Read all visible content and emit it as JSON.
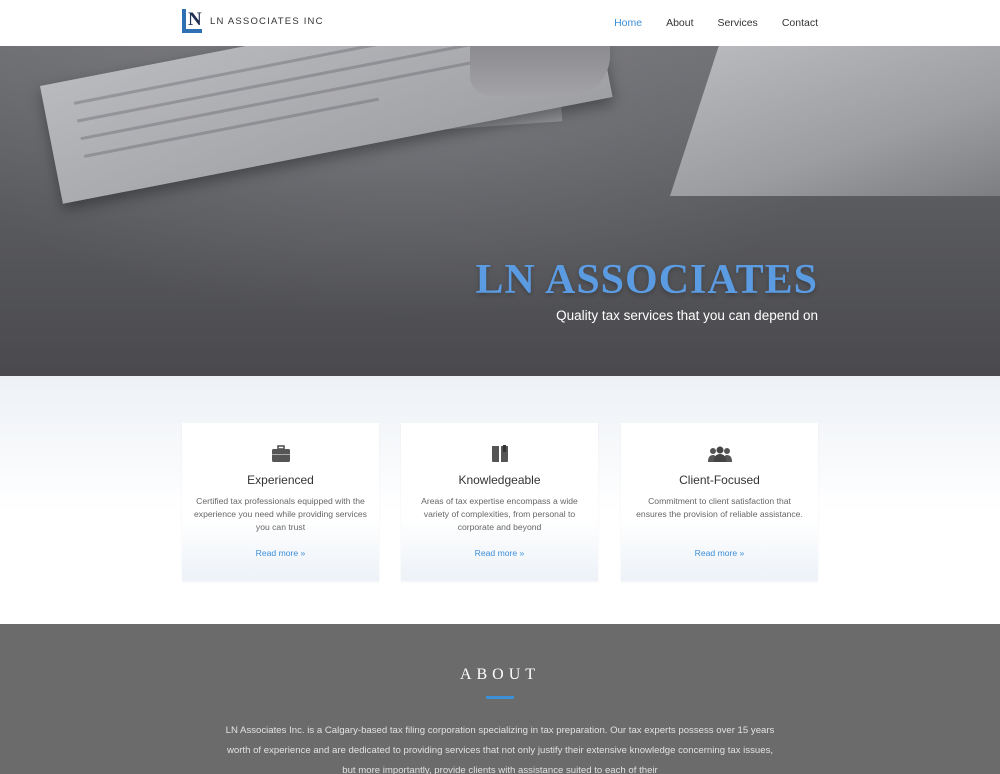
{
  "header": {
    "logo_text": "LN ASSOCIATES INC",
    "logo_letters": "N",
    "nav": [
      {
        "label": "Home",
        "active": true
      },
      {
        "label": "About",
        "active": false
      },
      {
        "label": "Services",
        "active": false
      },
      {
        "label": "Contact",
        "active": false
      }
    ]
  },
  "hero": {
    "title": "LN ASSOCIATES",
    "subtitle": "Quality tax services that you can depend on"
  },
  "features": [
    {
      "icon": "briefcase-icon",
      "title": "Experienced",
      "text": "Certified tax professionals equipped with the experience you need while providing services you can trust",
      "link": "Read more »"
    },
    {
      "icon": "book-icon",
      "title": "Knowledgeable",
      "text": "Areas of tax expertise encompass a wide variety of complexities, from personal to corporate and beyond",
      "link": "Read more »"
    },
    {
      "icon": "users-icon",
      "title": "Client-Focused",
      "text": "Commitment to client satisfaction that ensures the provision of reliable assistance.",
      "link": "Read more »"
    }
  ],
  "about": {
    "heading": "ABOUT",
    "text": "LN Associates Inc. is a Calgary-based tax filing corporation specializing in tax preparation. Our tax experts possess over 15 years worth of experience and are dedicated to providing services that not only justify their extensive knowledge concerning tax issues, but more importantly, provide clients with assistance suited to each of their"
  },
  "colors": {
    "accent": "#3d8fd8",
    "hero_title": "#5b9be2",
    "about_bg": "#6b6b6b"
  }
}
